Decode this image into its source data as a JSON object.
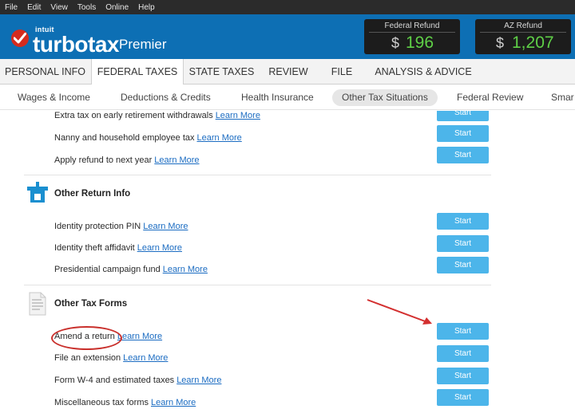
{
  "menu": [
    "File",
    "Edit",
    "View",
    "Tools",
    "Online",
    "Help"
  ],
  "header": {
    "intuit": "intuit",
    "brand": "turbotax",
    "edition": "Premier",
    "federal_refund": {
      "label": "Federal Refund",
      "currency": "$",
      "amount": "196"
    },
    "az_refund": {
      "label": "AZ Refund",
      "currency": "$",
      "amount": "1,207"
    }
  },
  "tabs": [
    "PERSONAL INFO",
    "FEDERAL TAXES",
    "STATE TAXES",
    "REVIEW",
    "FILE",
    "ANALYSIS & ADVICE"
  ],
  "active_tab": "FEDERAL TAXES",
  "subnav": [
    "Wages & Income",
    "Deductions & Credits",
    "Health Insurance",
    "Other Tax Situations",
    "Federal Review",
    "Smar"
  ],
  "active_subnav": "Other Tax Situations",
  "start_label": "Start",
  "learn_more": "Learn More",
  "top_items": [
    {
      "label": "Extra tax on early retirement withdrawals"
    },
    {
      "label": "Nanny and household employee tax"
    },
    {
      "label": "Apply refund to next year"
    }
  ],
  "sections": [
    {
      "title": "Other Return Info",
      "icon": "tax-return-icon",
      "items": [
        {
          "label": "Identity protection PIN"
        },
        {
          "label": "Identity theft affidavit"
        },
        {
          "label": "Presidential campaign fund"
        }
      ]
    },
    {
      "title": "Other Tax Forms",
      "icon": "tax-form-document-icon",
      "items": [
        {
          "label": "Amend a return"
        },
        {
          "label": "File an extension"
        },
        {
          "label": "Form W-4 and estimated taxes"
        },
        {
          "label": "Miscellaneous tax forms"
        }
      ]
    }
  ],
  "annotations": {
    "ellipse_color": "#c9302c",
    "arrow_color": "#d32f2f"
  },
  "colors": {
    "header_blue": "#0d6fb4",
    "start_button": "#4cb5ea",
    "refund_green": "#5fd047",
    "link": "#1b6cc2"
  }
}
